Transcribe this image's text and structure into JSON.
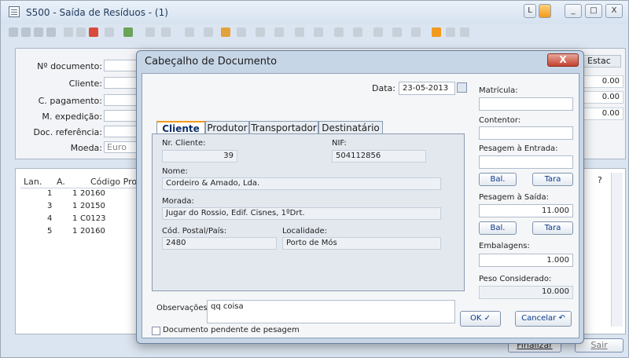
{
  "window": {
    "title": "S500 - Saída de Resíduos - (1)",
    "controls": [
      "L",
      "_",
      "□",
      "X"
    ]
  },
  "outer_form": {
    "labels": {
      "documento": "Nº documento:",
      "cliente": "Cliente:",
      "pagamento": "C. pagamento:",
      "expedicao": "M. expedição:",
      "referencia": "Doc. referência:",
      "moeda": "Moeda:"
    },
    "moeda_value": "Euro",
    "estado_header": "Estac",
    "right_values": [
      "0.00",
      "0.00",
      "0.00"
    ]
  },
  "grid": {
    "headers": [
      "Lan.",
      "A.",
      "Código Produ"
    ],
    "rows": [
      [
        "1",
        "1",
        "20160"
      ],
      [
        "3",
        "1",
        "20150"
      ],
      [
        "4",
        "1",
        "C0123"
      ],
      [
        "5",
        "1",
        "20160"
      ]
    ],
    "right_header": "?"
  },
  "footer": {
    "finalizar": "Finalizar",
    "sair": "Sair"
  },
  "dialog": {
    "title": "Cabeçalho de Documento",
    "close": "X",
    "data_label": "Data:",
    "data_value": "23-05-2013",
    "tabs": [
      "Cliente",
      "Produtor",
      "Transportador",
      "Destinatário"
    ],
    "cliente": {
      "nr_label": "Nr. Cliente:",
      "nr_value": "39",
      "nif_label": "NIF:",
      "nif_value": "504112856",
      "nome_label": "Nome:",
      "nome_value": "Cordeiro & Amado, Lda.",
      "morada_label": "Morada:",
      "morada_value": "Jugar do Rossio, Edif. Cisnes, 1ºDrt.",
      "postal_label": "Cód. Postal/País:",
      "postal_value": "2480",
      "localidade_label": "Localidade:",
      "localidade_value": "Porto de Mós"
    },
    "observacoes_label": "Observações:",
    "observacoes_value": "qq coisa",
    "pendente_label": "Documento pendente de pesagem",
    "right": {
      "matricula_label": "Matrícula:",
      "contentor_label": "Contentor:",
      "pesagem_entrada_label": "Pesagem à Entrada:",
      "bal": "Bal.",
      "tara": "Tara",
      "pesagem_saida_label": "Pesagem à Saída:",
      "pesagem_saida_value": "11.000",
      "embalagens_label": "Embalagens:",
      "embalagens_value": "1.000",
      "peso_label": "Peso Considerado:",
      "peso_value": "10.000"
    },
    "ok": "OK",
    "cancelar": "Cancelar"
  }
}
